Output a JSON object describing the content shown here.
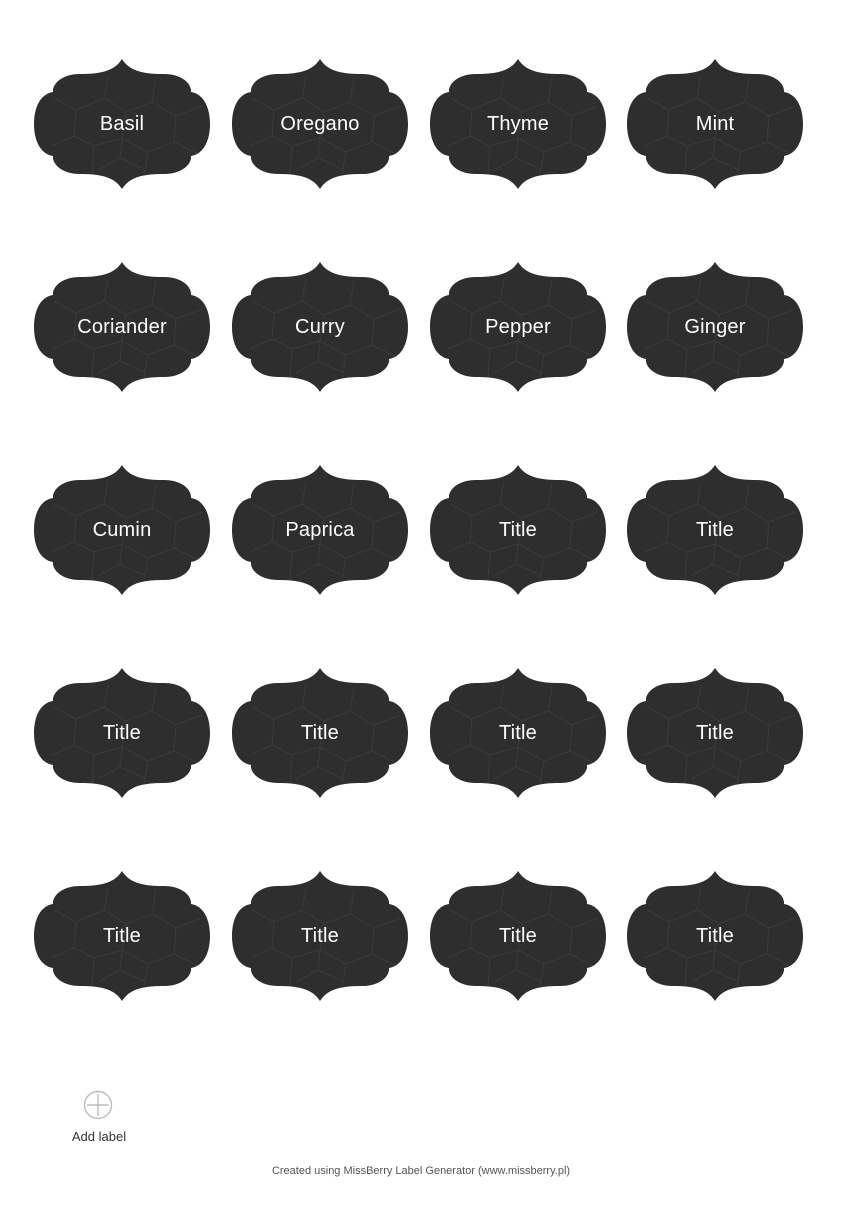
{
  "theme": {
    "label_color": "#2e2e2e",
    "pattern_color": "#3b3b3b",
    "text_color": "#ffffff",
    "icon_color": "#bdbdbd"
  },
  "labels": [
    {
      "title": "Basil"
    },
    {
      "title": "Oregano"
    },
    {
      "title": "Thyme"
    },
    {
      "title": "Mint"
    },
    {
      "title": "Coriander"
    },
    {
      "title": "Curry"
    },
    {
      "title": "Pepper"
    },
    {
      "title": "Ginger"
    },
    {
      "title": "Cumin"
    },
    {
      "title": "Paprica"
    },
    {
      "title": "Title"
    },
    {
      "title": "Title"
    },
    {
      "title": "Title"
    },
    {
      "title": "Title"
    },
    {
      "title": "Title"
    },
    {
      "title": "Title"
    },
    {
      "title": "Title"
    },
    {
      "title": "Title"
    },
    {
      "title": "Title"
    },
    {
      "title": "Title"
    }
  ],
  "add_label": {
    "icon": "plus-circle-icon",
    "text": "Add label"
  },
  "footer": {
    "text": "Created using MissBerry Label Generator (www.missberry.pl)"
  }
}
